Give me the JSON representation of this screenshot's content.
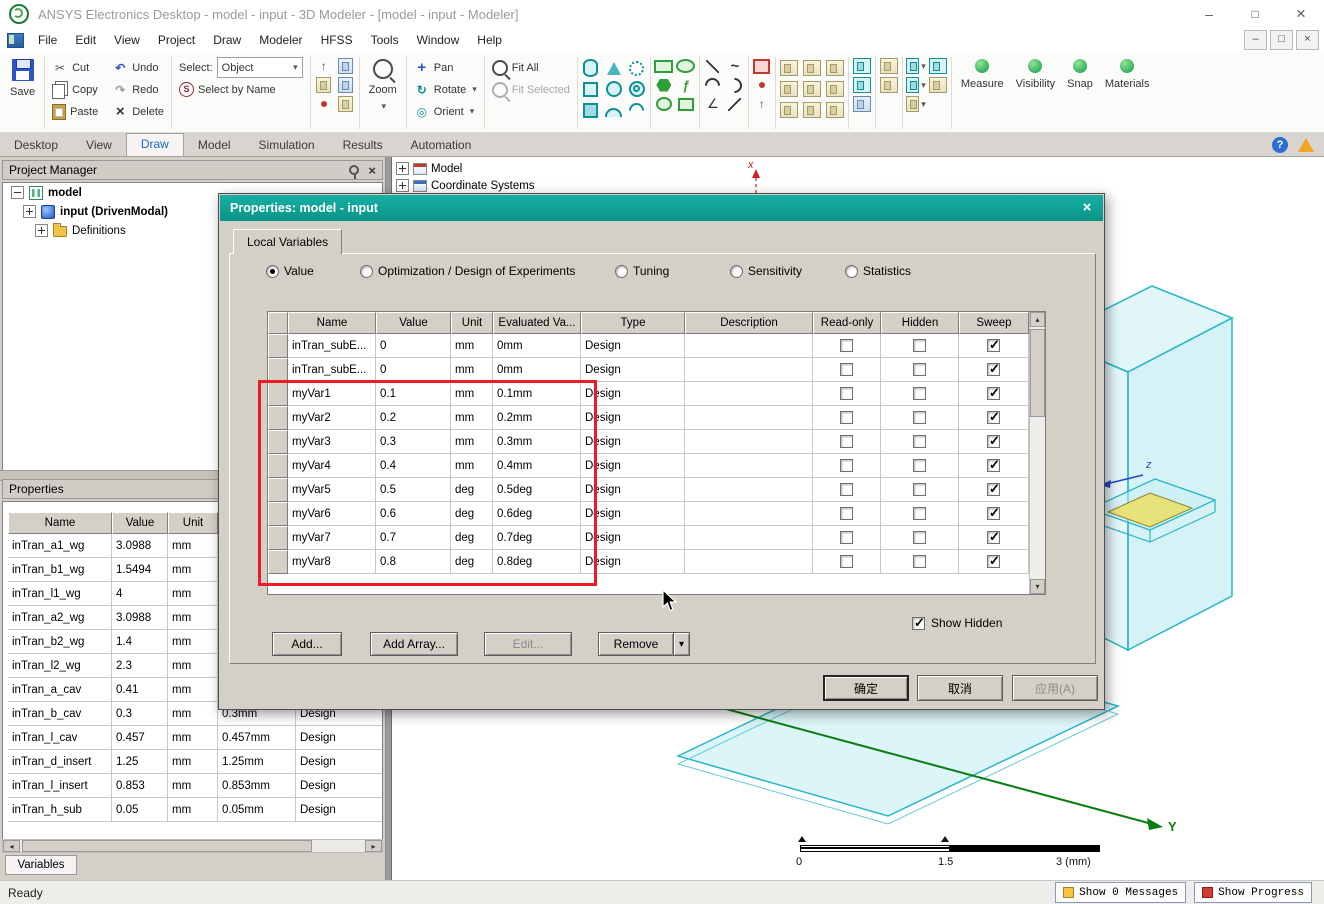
{
  "titlebar": {
    "title": "ANSYS Electronics Desktop - model - input - 3D Modeler - [model - input - Modeler]"
  },
  "menubar": {
    "items": [
      "File",
      "Edit",
      "View",
      "Project",
      "Draw",
      "Modeler",
      "HFSS",
      "Tools",
      "Window",
      "Help"
    ]
  },
  "toolbar": {
    "save": "Save",
    "cut": "Cut",
    "copy": "Copy",
    "pa )ste": "",
    "paste": "Paste",
    "undo": "Undo",
    "redo": "Redo",
    "delete": "Delete",
    "select_label": "Select:",
    "select_value": "Object",
    "select_by_name": "Select by Name",
    "zoom": "Zoom",
    "pan": "Pan",
    "rotate": "Rotate",
    "orient": "Orient",
    "fit_all": "Fit All",
    "fit_selected": "Fit Selected",
    "measure": "Measure",
    "visibility": "Visibility",
    "snap": "Snap",
    "materials": "Materials"
  },
  "ribbon": {
    "tabs": [
      "Desktop",
      "View",
      "Draw",
      "Model",
      "Simulation",
      "Results",
      "Automation"
    ],
    "active": "Draw"
  },
  "project_manager": {
    "title": "Project Manager",
    "items": [
      {
        "label": "model"
      },
      {
        "label": "input (DrivenModal)"
      },
      {
        "label": "Definitions"
      }
    ]
  },
  "properties_panel": {
    "title": "Properties",
    "headers": [
      "Name",
      "Value",
      "Unit"
    ],
    "rows": [
      {
        "name": "inTran_a1_wg",
        "value": "3.0988",
        "unit": "mm",
        "evaluated": "",
        "type": ""
      },
      {
        "name": "inTran_b1_wg",
        "value": "1.5494",
        "unit": "mm",
        "evaluated": "",
        "type": ""
      },
      {
        "name": "inTran_l1_wg",
        "value": "4",
        "unit": "mm",
        "evaluated": "",
        "type": ""
      },
      {
        "name": "inTran_a2_wg",
        "value": "3.0988",
        "unit": "mm",
        "evaluated": "",
        "type": ""
      },
      {
        "name": "inTran_b2_wg",
        "value": "1.4",
        "unit": "mm",
        "evaluated": "",
        "type": ""
      },
      {
        "name": "inTran_l2_wg",
        "value": "2.3",
        "unit": "mm",
        "evaluated": "",
        "type": ""
      },
      {
        "name": "inTran_a_cav",
        "value": "0.41",
        "unit": "mm",
        "evaluated": "",
        "type": ""
      },
      {
        "name": "inTran_b_cav",
        "value": "0.3",
        "unit": "mm",
        "evaluated": "0.3mm",
        "type": "Design"
      },
      {
        "name": "inTran_l_cav",
        "value": "0.457",
        "unit": "mm",
        "evaluated": "0.457mm",
        "type": "Design"
      },
      {
        "name": "inTran_d_insert",
        "value": "1.25",
        "unit": "mm",
        "evaluated": "1.25mm",
        "type": "Design"
      },
      {
        "name": "inTran_l_insert",
        "value": "0.853",
        "unit": "mm",
        "evaluated": "0.853mm",
        "type": "Design"
      },
      {
        "name": "inTran_h_sub",
        "value": "0.05",
        "unit": "mm",
        "evaluated": "0.05mm",
        "type": "Design"
      }
    ],
    "tab": "Variables"
  },
  "model_tree": {
    "items": [
      "Model",
      "Coordinate Systems"
    ]
  },
  "viewport": {
    "scale": {
      "start": "0",
      "mid": "1.5",
      "end": "3 (mm)"
    },
    "axis_x": "x",
    "axis_y": "Y",
    "axis_z": "z"
  },
  "dialog": {
    "title": "Properties: model - input",
    "tab": "Local Variables",
    "radios": [
      {
        "label": "Value",
        "selected": true
      },
      {
        "label": "Optimization / Design of Experiments",
        "selected": false
      },
      {
        "label": "Tuning",
        "selected": false
      },
      {
        "label": "Sensitivity",
        "selected": false
      },
      {
        "label": "Statistics",
        "selected": false
      }
    ],
    "table": {
      "headers": [
        "Name",
        "Value",
        "Unit",
        "Evaluated Va...",
        "Type",
        "Description",
        "Read-only",
        "Hidden",
        "Sweep"
      ],
      "rows": [
        {
          "name": "inTran_subE...",
          "value": "0",
          "unit": "mm",
          "evaluated": "0mm",
          "type": "Design",
          "readonly": false,
          "hidden": false,
          "sweep": true
        },
        {
          "name": "inTran_subE...",
          "value": "0",
          "unit": "mm",
          "evaluated": "0mm",
          "type": "Design",
          "readonly": false,
          "hidden": false,
          "sweep": true
        },
        {
          "name": "myVar1",
          "value": "0.1",
          "unit": "mm",
          "evaluated": "0.1mm",
          "type": "Design",
          "readonly": false,
          "hidden": false,
          "sweep": true
        },
        {
          "name": "myVar2",
          "value": "0.2",
          "unit": "mm",
          "evaluated": "0.2mm",
          "type": "Design",
          "readonly": false,
          "hidden": false,
          "sweep": true
        },
        {
          "name": "myVar3",
          "value": "0.3",
          "unit": "mm",
          "evaluated": "0.3mm",
          "type": "Design",
          "readonly": false,
          "hidden": false,
          "sweep": true
        },
        {
          "name": "myVar4",
          "value": "0.4",
          "unit": "mm",
          "evaluated": "0.4mm",
          "type": "Design",
          "readonly": false,
          "hidden": false,
          "sweep": true
        },
        {
          "name": "myVar5",
          "value": "0.5",
          "unit": "deg",
          "evaluated": "0.5deg",
          "type": "Design",
          "readonly": false,
          "hidden": false,
          "sweep": true
        },
        {
          "name": "myVar6",
          "value": "0.6",
          "unit": "deg",
          "evaluated": "0.6deg",
          "type": "Design",
          "readonly": false,
          "hidden": false,
          "sweep": true
        },
        {
          "name": "myVar7",
          "value": "0.7",
          "unit": "deg",
          "evaluated": "0.7deg",
          "type": "Design",
          "readonly": false,
          "hidden": false,
          "sweep": true
        },
        {
          "name": "myVar8",
          "value": "0.8",
          "unit": "deg",
          "evaluated": "0.8deg",
          "type": "Design",
          "readonly": false,
          "hidden": false,
          "sweep": true
        }
      ]
    },
    "buttons": {
      "add": "Add...",
      "add_array": "Add Array...",
      "edit": "Edit...",
      "remove": "Remove"
    },
    "show_hidden": "Show Hidden",
    "footer": {
      "ok": "确定",
      "cancel": "取消",
      "apply": "应用(A)"
    }
  },
  "statusbar": {
    "ready": "Ready",
    "messages": "Show 0 Messages",
    "progress": "Show Progress"
  }
}
